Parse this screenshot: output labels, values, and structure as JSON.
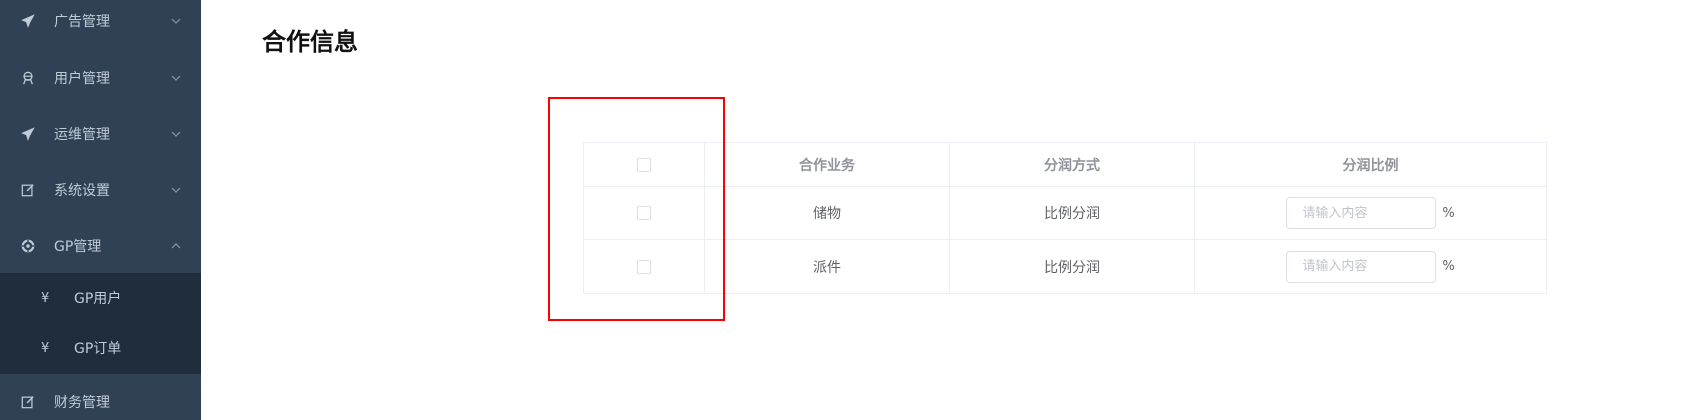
{
  "sidebar": {
    "items": [
      {
        "label": "广告管理",
        "icon": "paper-plane-icon",
        "expanded": false
      },
      {
        "label": "用户管理",
        "icon": "user-icon",
        "expanded": false
      },
      {
        "label": "运维管理",
        "icon": "paper-plane-icon",
        "expanded": false
      },
      {
        "label": "系统设置",
        "icon": "edit-icon",
        "expanded": false
      },
      {
        "label": "GP管理",
        "icon": "settings-circle-icon",
        "expanded": true
      },
      {
        "label": "财务管理",
        "icon": "edit-icon",
        "expanded": false
      }
    ],
    "submenu": [
      {
        "icon_text": "¥",
        "label": "GP用户"
      },
      {
        "icon_text": "¥",
        "label": "GP订单"
      }
    ]
  },
  "page": {
    "title": "合作信息"
  },
  "table": {
    "columns": [
      "合作业务",
      "分润方式",
      "分润比例"
    ],
    "rows": [
      {
        "business": "储物",
        "method": "比例分润",
        "ratio_placeholder": "请输入内容",
        "unit": "%"
      },
      {
        "business": "派件",
        "method": "比例分润",
        "ratio_placeholder": "请输入内容",
        "unit": "%"
      }
    ]
  },
  "colors": {
    "sidebar_bg": "#304156",
    "submenu_bg": "#1f2d3d",
    "highlight_border": "#ff0000"
  }
}
